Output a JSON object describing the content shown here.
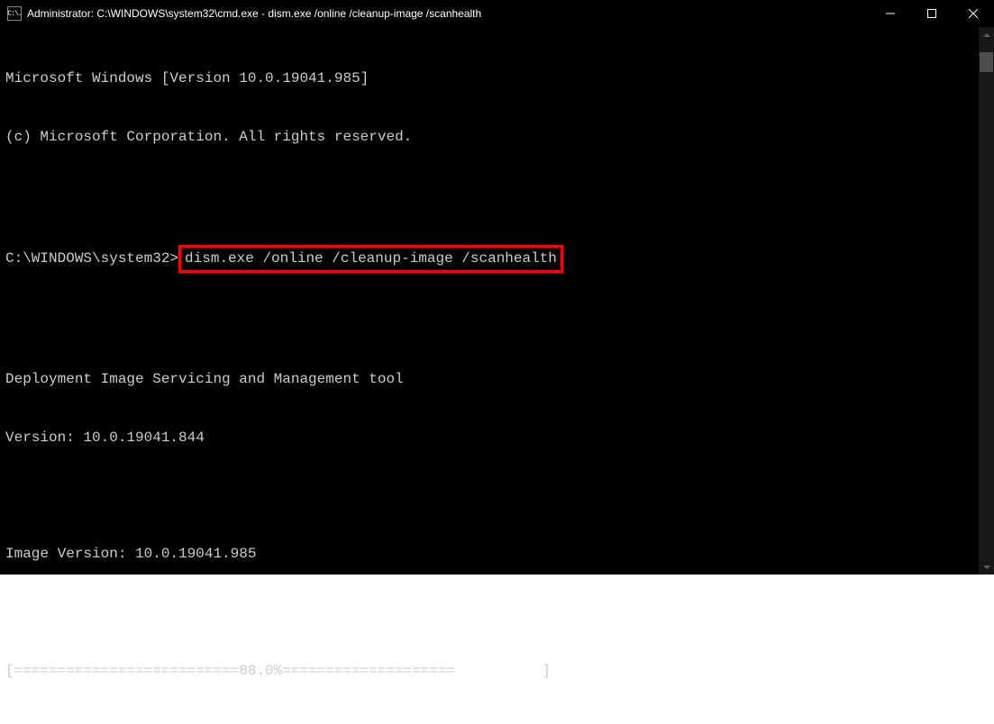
{
  "titlebar": {
    "icon_text": "C:\\.",
    "title": "Administrator: C:\\WINDOWS\\system32\\cmd.exe - dism.exe  /online /cleanup-image /scanhealth"
  },
  "terminal": {
    "line1": "Microsoft Windows [Version 10.0.19041.985]",
    "line2": "(c) Microsoft Corporation. All rights reserved.",
    "prompt_prefix": "C:\\WINDOWS\\system32>",
    "command": "dism.exe /online /cleanup-image /scanhealth",
    "line_tool": "Deployment Image Servicing and Management tool",
    "line_version": "Version: 10.0.19041.844",
    "line_image_version": "Image Version: 10.0.19041.985",
    "progress": "[==========================88.0%====================          ] "
  }
}
